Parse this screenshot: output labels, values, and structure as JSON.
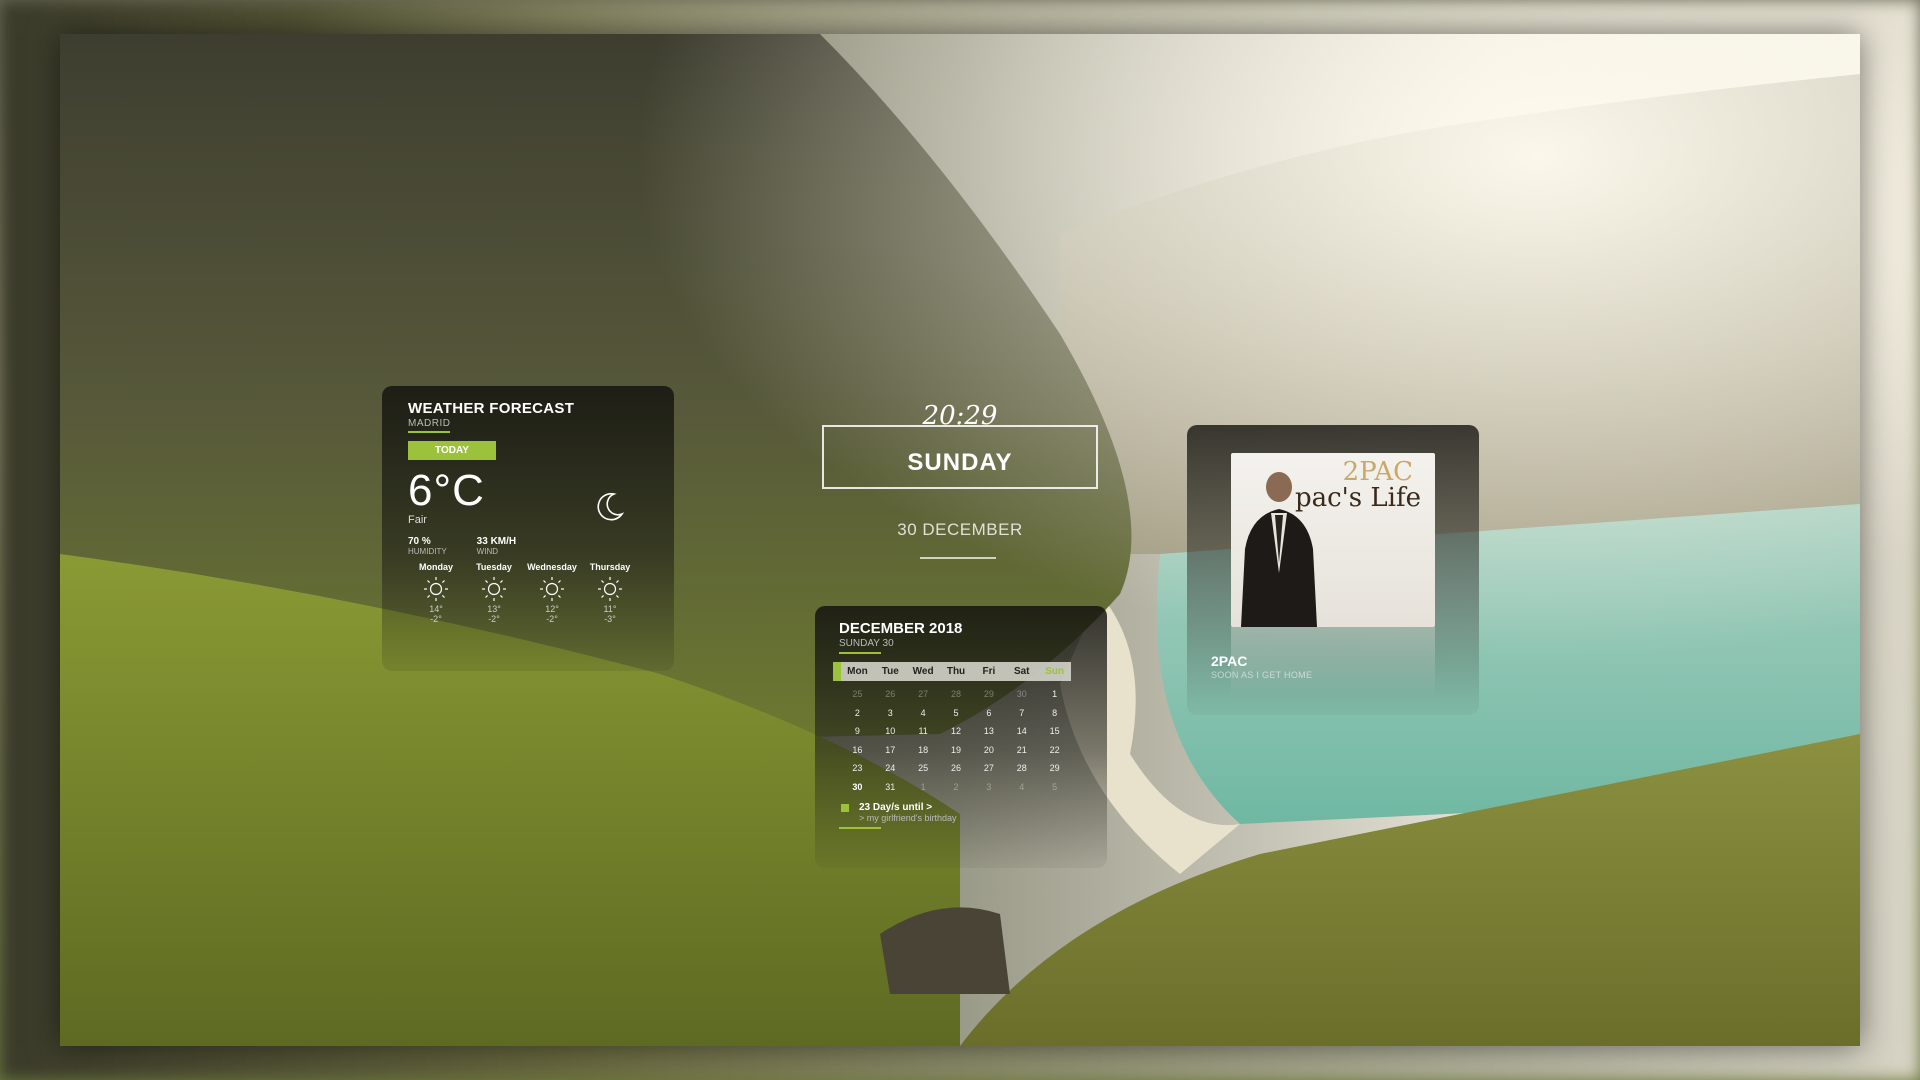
{
  "weather": {
    "title": "WEATHER FORECAST",
    "location": "MADRID",
    "today_label": "TODAY",
    "temperature": "6°C",
    "condition": "Fair",
    "humidity_value": "70 %",
    "humidity_label": "HUMIDITY",
    "wind_value": "33 KM/H",
    "wind_label": "WIND",
    "current_icon": "moon-icon",
    "days": [
      {
        "name": "Monday",
        "hi": "14°",
        "lo": "-2°",
        "icon": "sun-icon"
      },
      {
        "name": "Tuesday",
        "hi": "13°",
        "lo": "-2°",
        "icon": "sun-icon"
      },
      {
        "name": "Wednesday",
        "hi": "12°",
        "lo": "-2°",
        "icon": "sun-icon"
      },
      {
        "name": "Thursday",
        "hi": "11°",
        "lo": "-3°",
        "icon": "sun-icon"
      }
    ]
  },
  "clock": {
    "time": "20:29",
    "day": "SUNDAY",
    "date": "30 DECEMBER"
  },
  "calendar": {
    "title": "DECEMBER 2018",
    "subtitle": "SUNDAY 30",
    "weekdays": [
      "Mon",
      "Tue",
      "Wed",
      "Thu",
      "Fri",
      "Sat",
      "Sun"
    ],
    "weeks": [
      [
        "25",
        "26",
        "27",
        "28",
        "29",
        "30",
        "1"
      ],
      [
        "2",
        "3",
        "4",
        "5",
        "6",
        "7",
        "8"
      ],
      [
        "9",
        "10",
        "11",
        "12",
        "13",
        "14",
        "15"
      ],
      [
        "16",
        "17",
        "18",
        "19",
        "20",
        "21",
        "22"
      ],
      [
        "23",
        "24",
        "25",
        "26",
        "27",
        "28",
        "29"
      ],
      [
        "30",
        "31",
        "1",
        "2",
        "3",
        "4",
        "5"
      ]
    ],
    "event_title": "23 Day/s until >",
    "event_sub": "> my girlfriend's birthday"
  },
  "music": {
    "album_line1": "2PAC",
    "album_line2": "pac's Life",
    "artist": "2PAC",
    "song": "SOON AS I GET HOME"
  },
  "colors": {
    "accent": "#9bc23a"
  }
}
